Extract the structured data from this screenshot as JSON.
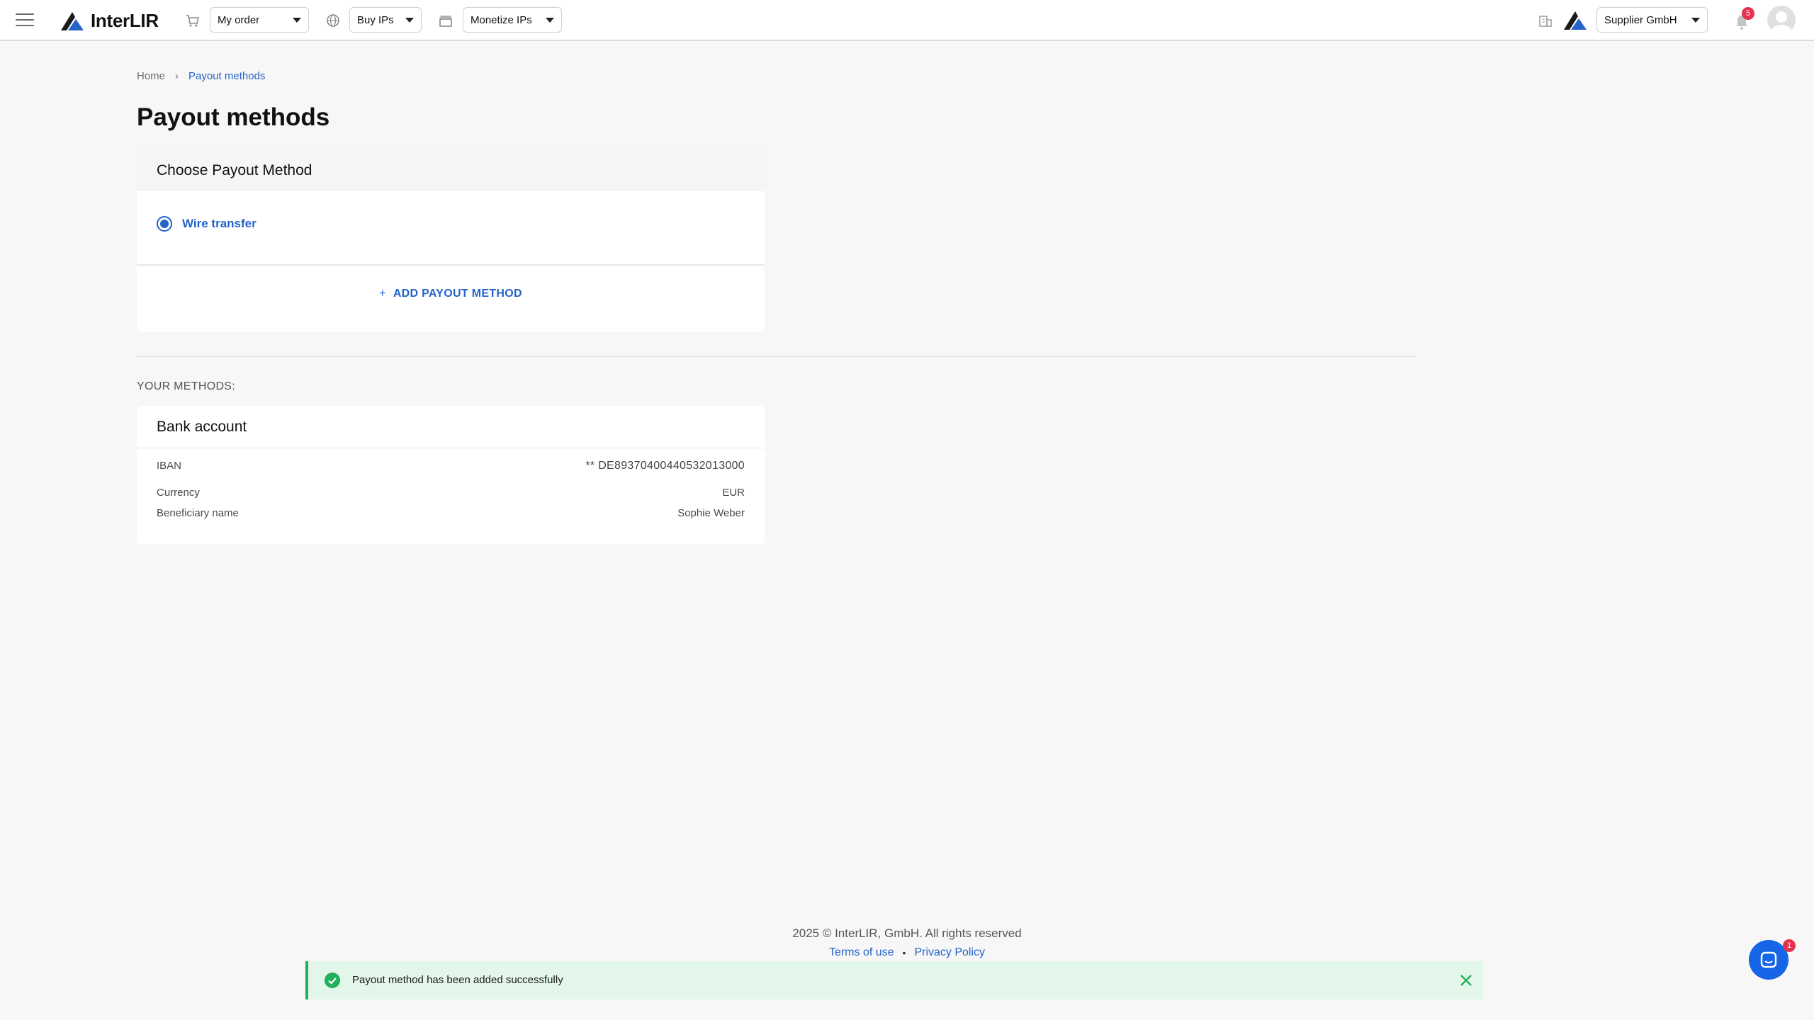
{
  "header": {
    "brand": "InterLIR",
    "my_order": "My order",
    "buy_ips": "Buy IPs",
    "monetize_ips": "Monetize IPs",
    "account": "Supplier GmbH",
    "notifications_count": "5",
    "icons": [
      "menu-icon",
      "cart-icon",
      "globe-icon",
      "store-icon",
      "building-icon",
      "bell-icon",
      "avatar"
    ]
  },
  "breadcrumb": {
    "home": "Home",
    "separator": "›",
    "current": "Payout methods"
  },
  "page": {
    "title": "Payout methods"
  },
  "choose": {
    "title": "Choose Payout Method",
    "option": "Wire transfer",
    "add_plus": "+",
    "add_label": "ADD PAYOUT METHOD"
  },
  "methods": {
    "section_label": "YOUR METHODS:",
    "bank": {
      "title": "Bank account",
      "iban_label": "IBAN",
      "iban_value": "** DE89370400440532013000",
      "currency_label": "Currency",
      "currency_value": "EUR",
      "beneficiary_label": "Beneficiary name",
      "beneficiary_value": "Sophie Weber"
    }
  },
  "footer": {
    "copyright": "2025 © InterLIR, GmbH. All rights reserved",
    "terms": "Terms of use",
    "dot": "•",
    "privacy": "Privacy Policy"
  },
  "toast": {
    "message": "Payout method has been added successfully"
  },
  "chat": {
    "badge": "1"
  },
  "colors": {
    "accent": "#2563c9",
    "success": "#22b05a",
    "badge": "#e5334f",
    "chat": "#1565e6"
  }
}
